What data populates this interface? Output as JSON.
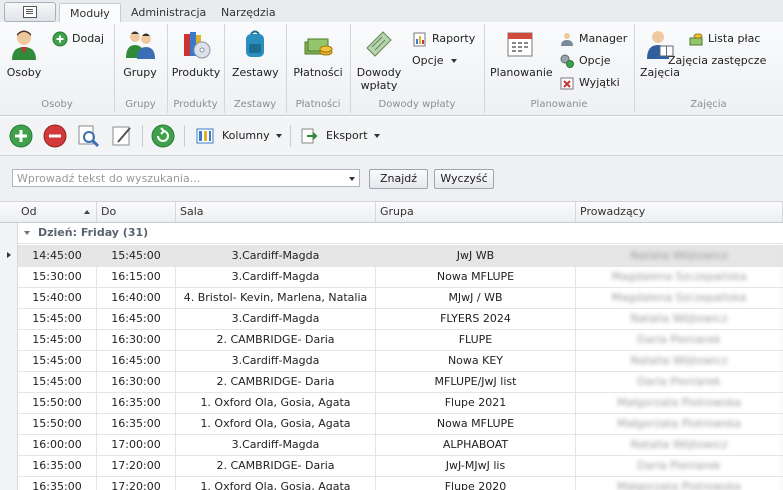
{
  "tabs": [
    "Moduły",
    "Administracja",
    "Narzędzia"
  ],
  "ribbon": {
    "groups": [
      {
        "label": "Osoby",
        "buttons": {
          "big": "Osoby",
          "small": "Dodaj"
        }
      },
      {
        "label": "Grupy",
        "buttons": {
          "big": "Grupy"
        }
      },
      {
        "label": "Produkty",
        "buttons": {
          "big": "Produkty"
        }
      },
      {
        "label": "Zestawy",
        "buttons": {
          "big": "Zestawy"
        }
      },
      {
        "label": "Płatności",
        "buttons": {
          "big": "Płatności"
        }
      },
      {
        "label": "Dowody wpłaty",
        "buttons": {
          "big_line1": "Dowody",
          "big_line2": "wpłaty",
          "small1": "Raporty",
          "small2": "Opcje"
        }
      },
      {
        "label": "Planowanie",
        "buttons": {
          "big": "Planowanie",
          "small1": "Manager",
          "small2": "Opcje",
          "small3": "Wyjątki"
        }
      },
      {
        "label": "Zajęcia",
        "buttons": {
          "big": "Zajęcia",
          "small1": "Lista płac",
          "small2": "Zajęcia zastępcze"
        }
      }
    ]
  },
  "toolbar": {
    "columns": "Kolumny",
    "export": "Eksport"
  },
  "search": {
    "placeholder": "Wprowadź tekst do wyszukania...",
    "find": "Znajdź",
    "clear": "Wyczyść"
  },
  "grid": {
    "columns": [
      "Od",
      "Do",
      "Sala",
      "Grupa",
      "Prowadzący"
    ],
    "group_header": "Dzień: Friday (31)",
    "rows": [
      {
        "od": "14:45:00",
        "do": "15:45:00",
        "sala": "3.Cardiff-Magda",
        "grupa": "JwJ WB",
        "prow": "Natalia Wójtowicz"
      },
      {
        "od": "15:30:00",
        "do": "16:15:00",
        "sala": "3.Cardiff-Magda",
        "grupa": "Nowa MFLUPE",
        "prow": "Magdalena Szczepańska"
      },
      {
        "od": "15:40:00",
        "do": "16:40:00",
        "sala": "4. Bristol- Kevin, Marlena, Natalia",
        "grupa": "MJwJ / WB",
        "prow": "Magdalena Szczepańska"
      },
      {
        "od": "15:45:00",
        "do": "16:45:00",
        "sala": "3.Cardiff-Magda",
        "grupa": "FLYERS 2024",
        "prow": "Natalia Wójtowicz"
      },
      {
        "od": "15:45:00",
        "do": "16:30:00",
        "sala": "2. CAMBRIDGE- Daria",
        "grupa": "FLUPE",
        "prow": "Daria Pieniarek"
      },
      {
        "od": "15:45:00",
        "do": "16:45:00",
        "sala": "3.Cardiff-Magda",
        "grupa": "Nowa KEY",
        "prow": "Natalia Wójtowicz"
      },
      {
        "od": "15:45:00",
        "do": "16:30:00",
        "sala": "2. CAMBRIDGE- Daria",
        "grupa": "MFLUPE/JwJ list",
        "prow": "Daria Pieniarek"
      },
      {
        "od": "15:50:00",
        "do": "16:35:00",
        "sala": "1. Oxford Ola, Gosia, Agata",
        "grupa": "Flupe 2021",
        "prow": "Małgorzata Piotrowska"
      },
      {
        "od": "15:50:00",
        "do": "16:35:00",
        "sala": "1. Oxford Ola, Gosia, Agata",
        "grupa": "Nowa MFLUPE",
        "prow": "Małgorzata Piotrowska"
      },
      {
        "od": "16:00:00",
        "do": "17:00:00",
        "sala": "3.Cardiff-Magda",
        "grupa": "ALPHABOAT",
        "prow": "Natalia Wójtowicz"
      },
      {
        "od": "16:35:00",
        "do": "17:20:00",
        "sala": "2. CAMBRIDGE- Daria",
        "grupa": "JwJ-MJwJ lis",
        "prow": "Daria Pieniarek"
      },
      {
        "od": "16:35:00",
        "do": "17:20:00",
        "sala": "1. Oxford Ola, Gosia, Agata",
        "grupa": "Flupe 2020",
        "prow": "Małgorzata Piotrowska"
      }
    ]
  },
  "colors": {
    "accent_green": "#2e9e3a",
    "accent_red": "#c83232",
    "selection": "#e6e6e6"
  }
}
